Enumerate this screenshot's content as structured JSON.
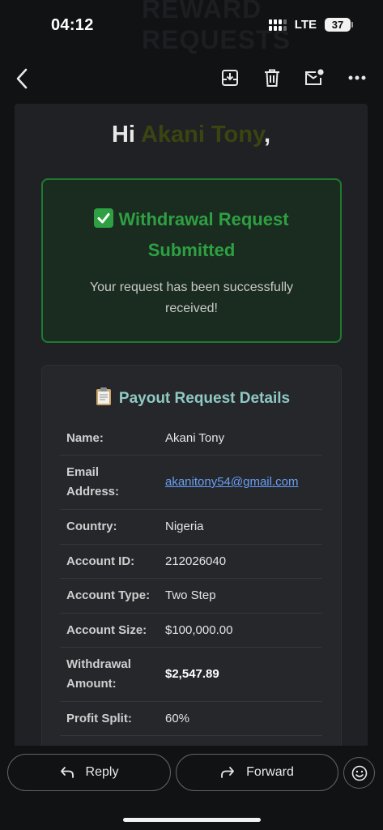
{
  "status": {
    "time": "04:12",
    "network": "LTE",
    "battery": "37"
  },
  "background_watermark": [
    "REWARD",
    "REQUESTS"
  ],
  "toolbar": {
    "back": "back-icon",
    "archive": "archive-icon",
    "delete": "trash-icon",
    "mark_unread": "mark-unread-icon",
    "more": "more-horizontal-icon"
  },
  "email": {
    "greeting_prefix": "Hi ",
    "greeting_name": "Akani Tony",
    "greeting_suffix": ",",
    "success": {
      "title": "Withdrawal Request Submitted",
      "message": "Your request has been successfully received!"
    },
    "details": {
      "title": "Payout Request Details",
      "rows": [
        {
          "label": "Name:",
          "value": "Akani Tony"
        },
        {
          "label": "Email Address:",
          "value": "akanitony54@gmail.com"
        },
        {
          "label": "Country:",
          "value": "Nigeria"
        },
        {
          "label": "Account ID:",
          "value": "212026040"
        },
        {
          "label": "Account Type:",
          "value": "Two Step"
        },
        {
          "label": "Account Size:",
          "value": "$100,000.00"
        },
        {
          "label": "Withdrawal Amount:",
          "value": "$2,547.89"
        },
        {
          "label": "Profit Split:",
          "value": "60%"
        }
      ]
    }
  },
  "actions": {
    "reply": "Reply",
    "forward": "Forward"
  },
  "colors": {
    "success_green": "#2ea043",
    "name_olive": "#3b4411",
    "details_title": "#8fc9c2",
    "link_blue": "#6a9ff5"
  }
}
